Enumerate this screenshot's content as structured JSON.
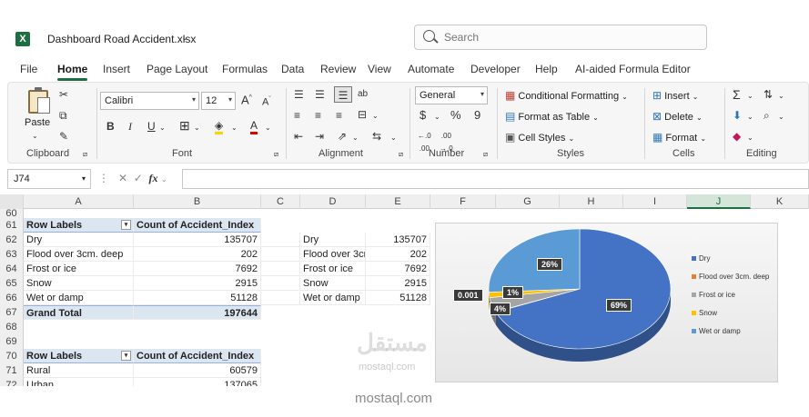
{
  "window": {
    "title": "Dashboard Road Accident.xlsx",
    "search_placeholder": "Search"
  },
  "menu": [
    "File",
    "Home",
    "Insert",
    "Page Layout",
    "Formulas",
    "Data",
    "Review",
    "View",
    "Automate",
    "Developer",
    "Help",
    "AI-aided Formula Editor"
  ],
  "ribbon": {
    "clipboard": {
      "label": "Clipboard",
      "paste": "Paste"
    },
    "font": {
      "label": "Font",
      "name": "Calibri",
      "size": "12"
    },
    "alignment": {
      "label": "Alignment"
    },
    "number": {
      "label": "Number",
      "format": "General"
    },
    "styles": {
      "label": "Styles",
      "conditional": "Conditional Formatting",
      "table": "Format as Table",
      "cell": "Cell Styles"
    },
    "cells": {
      "label": "Cells",
      "insert": "Insert",
      "delete": "Delete",
      "format": "Format"
    },
    "editing": {
      "label": "Editing"
    }
  },
  "formula_bar": {
    "name_box": "J74",
    "fx": "fx"
  },
  "columns": [
    "A",
    "B",
    "C",
    "D",
    "E",
    "F",
    "G",
    "H",
    "I",
    "J",
    "K"
  ],
  "rows": {
    "r60": "60",
    "r61": {
      "num": "61",
      "a": "Row Labels",
      "b": "Count of Accident_Index"
    },
    "r62": {
      "num": "62",
      "a": "Dry",
      "b": "135707",
      "d": "Dry",
      "e": "135707"
    },
    "r63": {
      "num": "63",
      "a": "Flood over 3cm. deep",
      "b": "202",
      "d": "Flood over 3cm. deep",
      "e": "202"
    },
    "r64": {
      "num": "64",
      "a": "Frost or ice",
      "b": "7692",
      "d": "Frost or ice",
      "e": "7692"
    },
    "r65": {
      "num": "65",
      "a": "Snow",
      "b": "2915",
      "d": "Snow",
      "e": "2915"
    },
    "r66": {
      "num": "66",
      "a": "Wet or damp",
      "b": "51128",
      "d": "Wet or damp",
      "e": "51128"
    },
    "r67": {
      "num": "67",
      "a": "Grand Total",
      "b": "197644"
    },
    "r68": "68",
    "r69": "69",
    "r70": {
      "num": "70",
      "a": "Row Labels",
      "b": "Count of Accident_Index"
    },
    "r71": {
      "num": "71",
      "a": "Rural",
      "b": "60579"
    },
    "r72": {
      "num": "72",
      "a": "Urban",
      "b": "137065"
    }
  },
  "chart_data": {
    "type": "pie",
    "categories": [
      "Dry",
      "Flood over 3cm. deep",
      "Frost or ice",
      "Snow",
      "Wet or damp"
    ],
    "values": [
      135707,
      202,
      7692,
      2915,
      51128
    ],
    "data_labels": [
      "69%",
      "0.001",
      "4%",
      "1%",
      "26%"
    ],
    "colors": [
      "#4472c4",
      "#ed7d31",
      "#a5a5a5",
      "#ffc000",
      "#5b9bd5"
    ],
    "legend_placement": "right",
    "legend": [
      "Dry",
      "Flood over 3cm. deep",
      "Frost or ice",
      "Snow",
      "Wet or damp"
    ]
  },
  "watermark": {
    "arabic": "مستقل",
    "url_small": "mostaql.com",
    "url": "mostaql.com"
  }
}
